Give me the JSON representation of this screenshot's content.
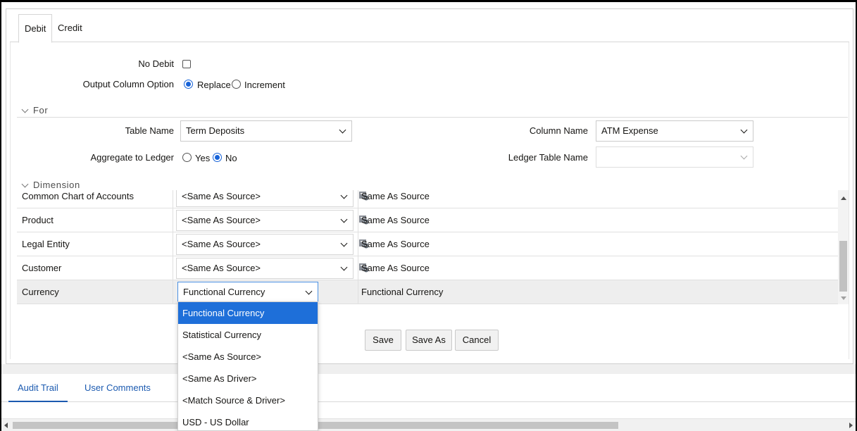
{
  "tabs": {
    "debit": "Debit",
    "credit": "Credit"
  },
  "options": {
    "no_debit_label": "No Debit",
    "no_debit_checked": false,
    "output_column_option_label": "Output Column Option",
    "replace_label": "Replace",
    "increment_label": "Increment",
    "selected_output": "Replace"
  },
  "for_section": {
    "header": "For",
    "table_name_label": "Table Name",
    "table_name_value": "Term Deposits",
    "column_name_label": "Column Name",
    "column_name_value": "ATM Expense",
    "aggregate_label": "Aggregate to Ledger",
    "yes_label": "Yes",
    "no_label": "No",
    "aggregate_selected": "No",
    "ledger_table_label": "Ledger Table Name",
    "ledger_table_value": ""
  },
  "dimension_section": {
    "header": "Dimension",
    "rows": [
      {
        "name": "Common Chart of Accounts",
        "select": "<Same As Source>",
        "value": "Same As Source"
      },
      {
        "name": "Product",
        "select": "<Same As Source>",
        "value": "Same As Source"
      },
      {
        "name": "Legal Entity",
        "select": "<Same As Source>",
        "value": "Same As Source"
      },
      {
        "name": "Customer",
        "select": "<Same As Source>",
        "value": "Same As Source"
      },
      {
        "name": "Currency",
        "select": "Functional Currency",
        "value": "Functional Currency"
      }
    ]
  },
  "dropdown": {
    "highlighted": "Functional Currency",
    "options": [
      "Functional Currency",
      "Statistical Currency",
      "<Same As Source>",
      "<Same As Driver>",
      "<Match Source & Driver>",
      "USD - US Dollar"
    ]
  },
  "buttons": {
    "save": "Save",
    "save_as": "Save As",
    "cancel": "Cancel"
  },
  "lower_tabs": {
    "audit_trail": "Audit Trail",
    "user_comments": "User Comments"
  },
  "colors": {
    "accent": "#1763d8",
    "highlight": "#1e6fd9",
    "link": "#1b5ab0"
  }
}
